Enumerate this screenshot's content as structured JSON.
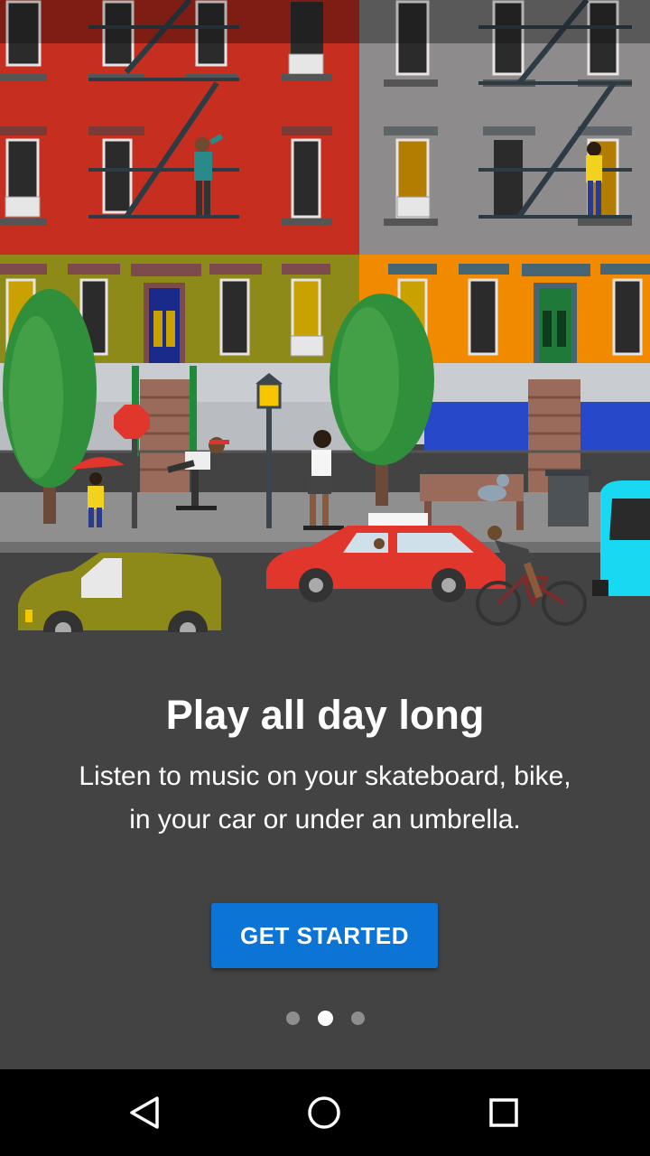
{
  "onboarding": {
    "title": "Play all day long",
    "subtitle_line1": "Listen to music on your skateboard, bike,",
    "subtitle_line2": "in your car or under an umbrella.",
    "cta_label": "GET STARTED",
    "page_count": 3,
    "current_page": 2
  },
  "illustration": {
    "scene": "city street with brownstone buildings, trees, skateboarders, bicycle, red taxi car, yellow van and cyan van"
  },
  "colors": {
    "background": "#434343",
    "accent": "#0b74d4",
    "dot_active": "#ffffff",
    "dot_inactive": "#8e8e8e",
    "nav_bar": "#000000"
  },
  "nav_bar": {
    "back_icon": "triangle-back-icon",
    "home_icon": "circle-home-icon",
    "recents_icon": "square-recents-icon"
  }
}
